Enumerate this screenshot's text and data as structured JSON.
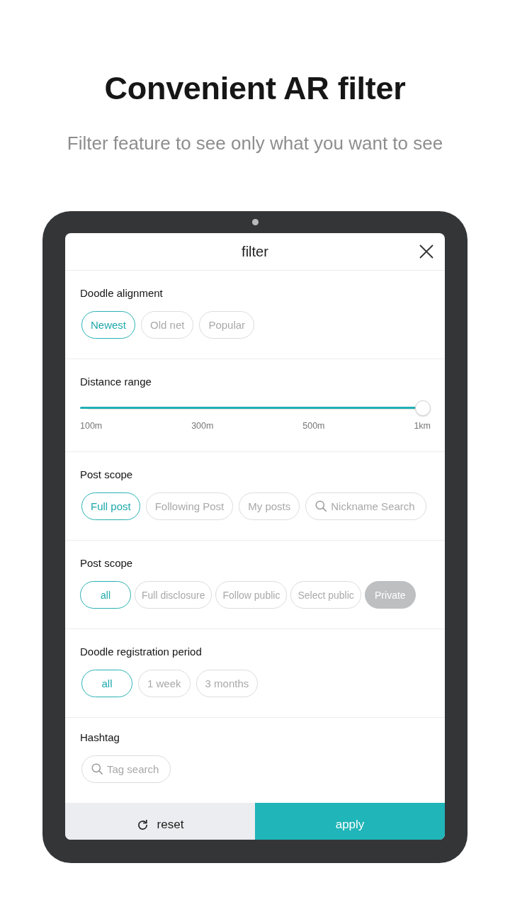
{
  "headline": "Convenient AR filter",
  "subtitle": "Filter feature to see only what you want to see",
  "dialog": {
    "title": "filter",
    "sections": [
      {
        "kind": "chips",
        "label": "Doodle alignment",
        "options": [
          {
            "kind": "option",
            "label": "Newest",
            "selected": true,
            "disabled": false
          },
          {
            "kind": "option",
            "label": "Old net",
            "selected": false,
            "disabled": false
          },
          {
            "kind": "option",
            "label": "Popular",
            "selected": false,
            "disabled": false
          }
        ]
      },
      {
        "kind": "slider",
        "label": "Distance range",
        "level": 1,
        "ticks": [
          "100m",
          "300m",
          "500m",
          "1km"
        ]
      },
      {
        "kind": "chips",
        "label": "Post scope",
        "options": [
          {
            "kind": "option",
            "label": "Full post",
            "selected": true,
            "disabled": false
          },
          {
            "kind": "option",
            "label": "Following Post",
            "selected": false,
            "disabled": false
          },
          {
            "kind": "option",
            "label": "My posts",
            "selected": false,
            "disabled": false
          },
          {
            "kind": "search",
            "placeholder": "Nickname Search"
          }
        ]
      },
      {
        "kind": "chips",
        "label": "Post scope",
        "options": [
          {
            "kind": "option",
            "label": "all",
            "selected": true,
            "disabled": false
          },
          {
            "kind": "option",
            "label": "Full disclosure",
            "selected": false,
            "disabled": false
          },
          {
            "kind": "option",
            "label": "Follow public",
            "selected": false,
            "disabled": false
          },
          {
            "kind": "option",
            "label": "Select public",
            "selected": false,
            "disabled": false
          },
          {
            "kind": "option",
            "label": "Private",
            "selected": false,
            "disabled": true
          }
        ]
      },
      {
        "kind": "chips",
        "label": "Doodle registration period",
        "options": [
          {
            "kind": "option",
            "label": "all",
            "selected": true,
            "disabled": false
          },
          {
            "kind": "option",
            "label": "1 week",
            "selected": false,
            "disabled": false
          },
          {
            "kind": "option",
            "label": "3 months",
            "selected": false,
            "disabled": false
          }
        ]
      },
      {
        "kind": "chips",
        "label": "Hashtag",
        "options": [
          {
            "kind": "search",
            "placeholder": "Tag search"
          }
        ]
      }
    ],
    "buttons": [
      {
        "kind": "reset",
        "label": "reset"
      },
      {
        "kind": "apply",
        "label": "apply"
      }
    ]
  }
}
